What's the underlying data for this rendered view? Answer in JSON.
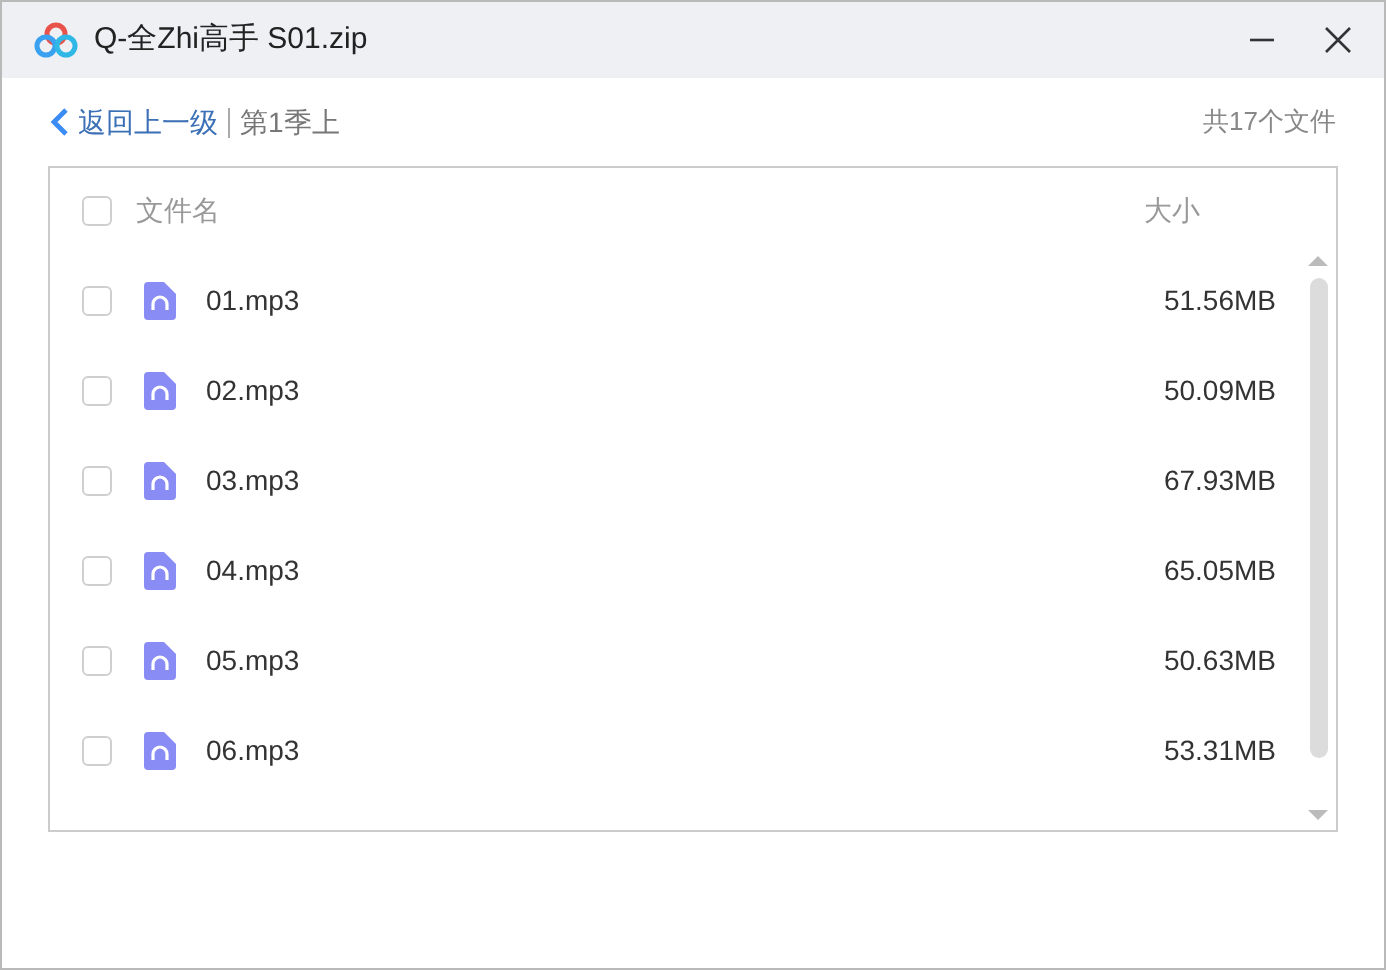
{
  "window": {
    "title": "Q-全Zhi高手 S01.zip"
  },
  "nav": {
    "back": "返回上一级",
    "current": "第1季上",
    "count": "共17个文件"
  },
  "table": {
    "header": {
      "checked": false,
      "name": "文件名",
      "size": "大小"
    },
    "rows": [
      {
        "name": "01.mp3",
        "size": "51.56MB",
        "checked": false
      },
      {
        "name": "02.mp3",
        "size": "50.09MB",
        "checked": false
      },
      {
        "name": "03.mp3",
        "size": "67.93MB",
        "checked": false
      },
      {
        "name": "04.mp3",
        "size": "65.05MB",
        "checked": false
      },
      {
        "name": "05.mp3",
        "size": "50.63MB",
        "checked": false
      },
      {
        "name": "06.mp3",
        "size": "53.31MB",
        "checked": false
      }
    ]
  }
}
